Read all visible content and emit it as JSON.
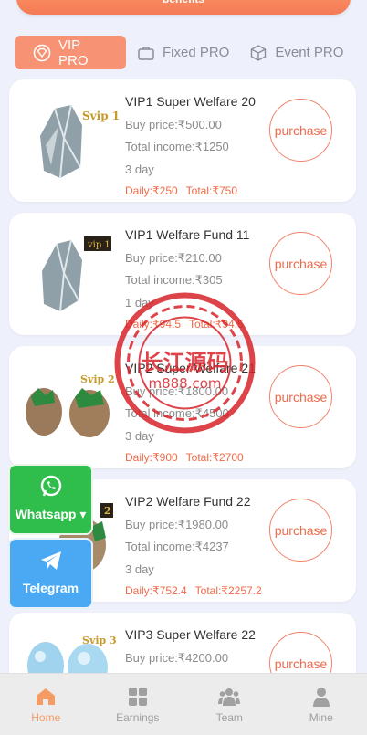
{
  "banner": {
    "text": "benefits"
  },
  "tabs": [
    {
      "label": "VIP PRO",
      "icon": "diamond-icon"
    },
    {
      "label": "Fixed PRO",
      "icon": "briefcase-icon"
    },
    {
      "label": "Event PRO",
      "icon": "box-icon"
    }
  ],
  "products": [
    {
      "title": "VIP1 Super Welfare 20",
      "buy_price": "Buy price:₹500.00",
      "total_income": "Total income:₹1250",
      "period": "3 day",
      "daily": "Daily:₹250",
      "total": "Total:₹750",
      "action": "purchase",
      "badge": "Svip 1"
    },
    {
      "title": "VIP1 Welfare Fund 11",
      "buy_price": "Buy price:₹210.00",
      "total_income": "Total income:₹305",
      "period": "1 day",
      "daily": "Daily:₹94.5",
      "total": "Total:₹94.5",
      "action": "purchase",
      "badge": "vip 1"
    },
    {
      "title": "VIP2 Super Welfare 21",
      "buy_price": "Buy price:₹1800.00",
      "total_income": "Total income:₹4500",
      "period": "3 day",
      "daily": "Daily:₹900",
      "total": "Total:₹2700",
      "action": "purchase",
      "badge": "Svip 2"
    },
    {
      "title": "VIP2 Welfare Fund 22",
      "buy_price": "Buy price:₹1980.00",
      "total_income": "Total income:₹4237",
      "period": "3 day",
      "daily": "Daily:₹752.4",
      "total": "Total:₹2257.2",
      "action": "purchase",
      "badge": "2"
    },
    {
      "title": "VIP3 Super Welfare 22",
      "buy_price": "Buy price:₹4200.00",
      "total_income": "",
      "period": "",
      "daily": "",
      "total": "",
      "action": "purchase",
      "badge": "Svip 3"
    }
  ],
  "floating": {
    "whatsapp": "Whatsapp",
    "telegram": "Telegram"
  },
  "watermark": {
    "line1": "长江源码",
    "line2": "m888.com"
  },
  "nav": [
    {
      "label": "Home",
      "icon": "home-icon"
    },
    {
      "label": "Earnings",
      "icon": "grid-icon"
    },
    {
      "label": "Team",
      "icon": "team-icon"
    },
    {
      "label": "Mine",
      "icon": "user-icon"
    }
  ],
  "colors": {
    "accent": "#f79275",
    "price_red": "#f06a4a",
    "whatsapp": "#2fbd4c",
    "telegram": "#4ba9f3",
    "nav_active": "#f59b64"
  }
}
